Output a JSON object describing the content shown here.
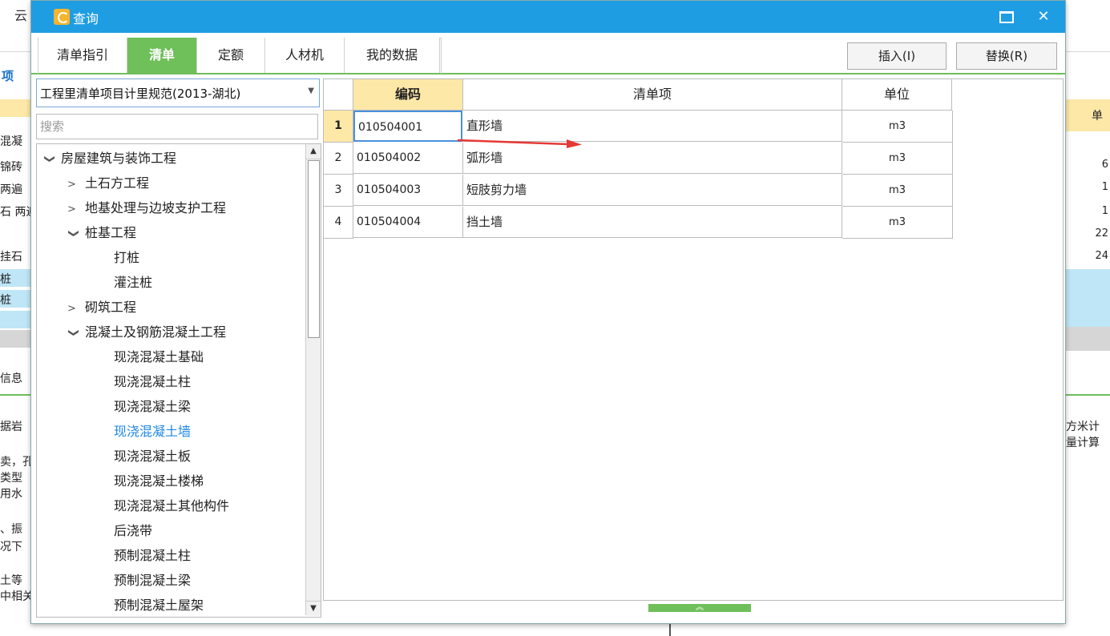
{
  "background_app": {
    "top_text": "云",
    "left_tab": "项",
    "left_rows": [
      "混凝",
      "锦砖",
      "两遍",
      "石 两遍",
      "挂石",
      "桩",
      "桩"
    ],
    "left_info_tab": "信息",
    "left_desc_lines": [
      "据岩",
      "卖，孔",
      "类型",
      "用水",
      "、振",
      "况下",
      "土等",
      "中相关"
    ],
    "right_header": "单",
    "right_values": [
      "6",
      "1",
      "1",
      "22",
      "24"
    ],
    "right_desc_lines": [
      "方米计",
      "量计算"
    ]
  },
  "dialog": {
    "title": "查询",
    "maximize_label": "",
    "close_label": "✕"
  },
  "tabs": [
    {
      "label": "清单指引",
      "active": false
    },
    {
      "label": "清单",
      "active": true
    },
    {
      "label": "定额",
      "active": false
    },
    {
      "label": "人材机",
      "active": false
    },
    {
      "label": "我的数据",
      "active": false
    }
  ],
  "toolbar": {
    "insert_label": "插入(I)",
    "replace_label": "替换(R)"
  },
  "spec_select": {
    "value": "工程里清单项目计里规范(2013-湖北)"
  },
  "search": {
    "placeholder": "搜索"
  },
  "tree": [
    {
      "label": "房屋建筑与装饰工程",
      "level": 0,
      "chevron": "expanded"
    },
    {
      "label": "土石方工程",
      "level": 1,
      "chevron": "collapsed"
    },
    {
      "label": "地基处理与边坡支护工程",
      "level": 1,
      "chevron": "collapsed"
    },
    {
      "label": "桩基工程",
      "level": 1,
      "chevron": "expanded"
    },
    {
      "label": "打桩",
      "level": 2,
      "chevron": "none"
    },
    {
      "label": "灌注桩",
      "level": 2,
      "chevron": "none"
    },
    {
      "label": "砌筑工程",
      "level": 1,
      "chevron": "collapsed"
    },
    {
      "label": "混凝土及钢筋混凝土工程",
      "level": 1,
      "chevron": "expanded"
    },
    {
      "label": "现浇混凝土基础",
      "level": 2,
      "chevron": "none"
    },
    {
      "label": "现浇混凝土柱",
      "level": 2,
      "chevron": "none"
    },
    {
      "label": "现浇混凝土梁",
      "level": 2,
      "chevron": "none"
    },
    {
      "label": "现浇混凝土墙",
      "level": 2,
      "chevron": "none",
      "selected": true
    },
    {
      "label": "现浇混凝土板",
      "level": 2,
      "chevron": "none"
    },
    {
      "label": "现浇混凝土楼梯",
      "level": 2,
      "chevron": "none"
    },
    {
      "label": "现浇混凝土其他构件",
      "level": 2,
      "chevron": "none"
    },
    {
      "label": "后浇带",
      "level": 2,
      "chevron": "none"
    },
    {
      "label": "预制混凝土柱",
      "level": 2,
      "chevron": "none"
    },
    {
      "label": "预制混凝土梁",
      "level": 2,
      "chevron": "none"
    },
    {
      "label": "预制混凝土屋架",
      "level": 2,
      "chevron": "none"
    }
  ],
  "grid": {
    "headers": {
      "code": "编码",
      "name": "清单项",
      "unit": "单位"
    },
    "rows": [
      {
        "num": "1",
        "code": "010504001",
        "name": "直形墙",
        "unit": "m3"
      },
      {
        "num": "2",
        "code": "010504002",
        "name": "弧形墙",
        "unit": "m3"
      },
      {
        "num": "3",
        "code": "010504003",
        "name": "短肢剪力墙",
        "unit": "m3"
      },
      {
        "num": "4",
        "code": "010504004",
        "name": "挡土墙",
        "unit": "m3"
      }
    ]
  },
  "colors": {
    "titlebar": "#1e9de3",
    "active_tab": "#6fbf5a",
    "header_highlight": "#fde8a8",
    "selected_tree_item": "#1e88e5",
    "annotation_arrow": "#e53935"
  },
  "icons": {
    "app": "app-logo-icon",
    "maximize": "maximize-icon",
    "close": "close-icon",
    "expand": "chevron-down-icon",
    "collapse": "chevron-right-icon",
    "dropdown": "dropdown-arrow-icon",
    "splitter": "chevron-up-icon"
  }
}
